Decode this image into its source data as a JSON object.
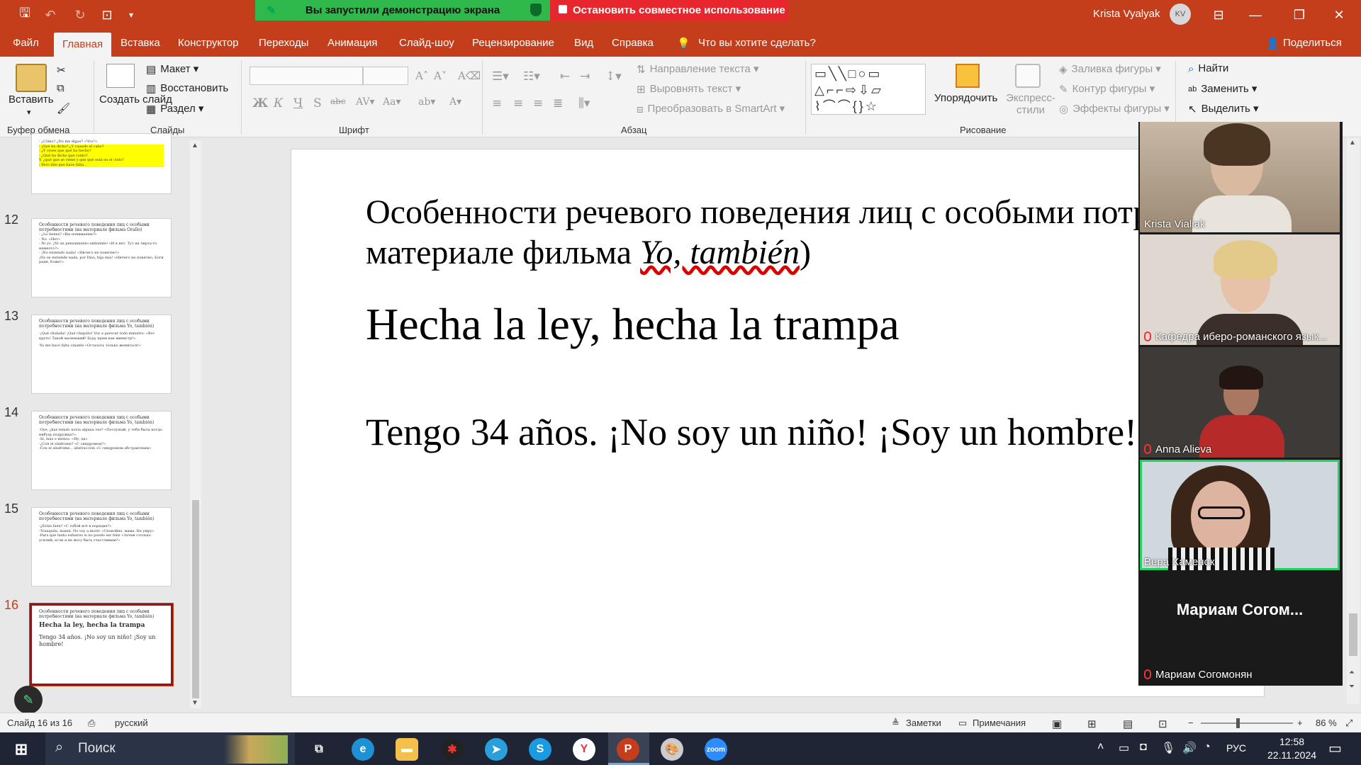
{
  "titlebar": {
    "share_banner": "Вы запустили демонстрацию экрана",
    "stop_share": "Остановить совместное использование",
    "user": "Krista Vyalyak",
    "avatar": "KV"
  },
  "menu": {
    "tabs": [
      "Файл",
      "Главная",
      "Вставка",
      "Конструктор",
      "Переходы",
      "Анимация",
      "Слайд-шоу",
      "Рецензирование",
      "Вид",
      "Справка"
    ],
    "tell_me": "Что вы хотите сделать?",
    "share": "Поделиться"
  },
  "ribbon": {
    "paste": "Вставить",
    "new_slide": "Создать слайд",
    "layout": "Макет",
    "reset": "Восстановить",
    "section": "Раздел",
    "groups": {
      "clipboard": "Буфер обмена",
      "slides": "Слайды",
      "font": "Шрифт",
      "paragraph": "Абзац",
      "drawing": "Рисование"
    },
    "text_direction": "Направление текста",
    "align_text": "Выровнять текст",
    "smartart": "Преобразовать в SmartArt",
    "arrange": "Упорядочить",
    "quick_styles": "Экспресс-стили",
    "shape_fill": "Заливка фигуры",
    "shape_outline": "Контур фигуры",
    "shape_effects": "Эффекты фигуры",
    "find": "Найти",
    "replace": "Заменить",
    "select": "Выделить"
  },
  "thumbnails": [
    {
      "num": "12",
      "title": "Особенности речевого поведения лиц с особыми потребностями (на материале фильма Orallo)",
      "lines": [
        "- ¿Lo tienes? «Вы понимаешь?»",
        "- No. «Нет»",
        "- Ni yo. ¡Ni un pensamiento ambiente! «И я нет. Тут на чирта-то немного?»",
        "- ¡No entiendo nada! «Ничего не понятно!»",
        "¡No se entiende nada, por Dios, hija mía! «Ничего не понятно, Боги ради, Боже!»"
      ]
    },
    {
      "num": "13",
      "title": "Особенности речевого поведения лиц с особыми потребностями (на материале фильма Yo, también)",
      "lines": [
        "-¡Qué chulada! ¡Qué chiquito! Voy a parecer todo ministro. «Вот круть! Такой маленький! Буду прям как министр!».",
        "-Ya me hace falta cinante «Осталось только жениться!»"
      ]
    },
    {
      "num": "14",
      "title": "Особенности речевого поведения лиц с особыми потребностями (на материале фильма Yo, también)",
      "lines": [
        "-Oye, ¿has tenido novia alguna vez? «Послушай, у тебя была когда-нибудь подружка?».",
        "-Sí, más o menos. «Ну, да»",
        "-¿Con el síndrome? «С синдромом?»",
        "-Con el síndrome... abstracción «С синдромом абстрактным»"
      ]
    },
    {
      "num": "15",
      "title": "Особенности речевого поведения лиц с особыми потребностями (на материале фильма Yo, también)",
      "lines": [
        "-¿Estás bien? «С тобой всё в порядке?»",
        "-Tranquila, mamá. No voy a morir. «Спокойно, мама. Не умру»",
        "-Para que tanto esfuerzo si no puedo ser feliz «Зачем столько усилий, если я не могу быть счастливым?»"
      ]
    },
    {
      "num": "16",
      "title": "Особенности речевого поведения лиц с особыми потребностями (на материале фильма Yo, también)",
      "heading": "Hecha la ley, hecha la trampa",
      "body": "Tengo 34 años. ¡No soy un niño! ¡Soy un hombre!"
    }
  ],
  "thumb_top": {
    "lines": [
      "- ¿Cómo? ¿No me digas? «Что?»",
      "- ¡Qué ha dicho? ¿Y cuando el cabo?",
      "- ¿Y crees que qué ha hecho?",
      "- ¿Qué ha dicho que contó?",
      "Y, ¿qué que se viene y que qué está en el cielo?",
      "- Pero dile que hace falta..."
    ]
  },
  "slide": {
    "title_plain": "Особенности речевого поведения лиц с особыми потребностями (на материале фильма ",
    "title_italic": "Yo, también",
    "title_end": ")",
    "heading": "Hecha la ley, hecha la trampa",
    "body": "Tengo 34 años. ¡No soy un niño! ¡Soy un hombre!"
  },
  "participants": [
    {
      "name": "Krista Vialiak",
      "muted": false
    },
    {
      "name": "Кафедра иберо-романского язык...",
      "muted": true
    },
    {
      "name": "Anna Alieva",
      "muted": true
    },
    {
      "name": "Вера Хаменок",
      "muted": false,
      "speaking": true
    },
    {
      "name": "Мариам Согомонян",
      "muted": true,
      "display": "Мариам Согом..."
    }
  ],
  "statusbar": {
    "slide_count": "Слайд 16 из 16",
    "language": "русский",
    "notes": "Заметки",
    "comments": "Примечания",
    "zoom": "86 %"
  },
  "taskbar": {
    "search": "Поиск",
    "lang": "РУС",
    "time": "12:58",
    "date": "22.11.2024"
  },
  "colors": {
    "accent": "#c43e1c",
    "share_green": "#2fb84b",
    "stop_red": "#e8262d",
    "speaking": "#23d160"
  }
}
